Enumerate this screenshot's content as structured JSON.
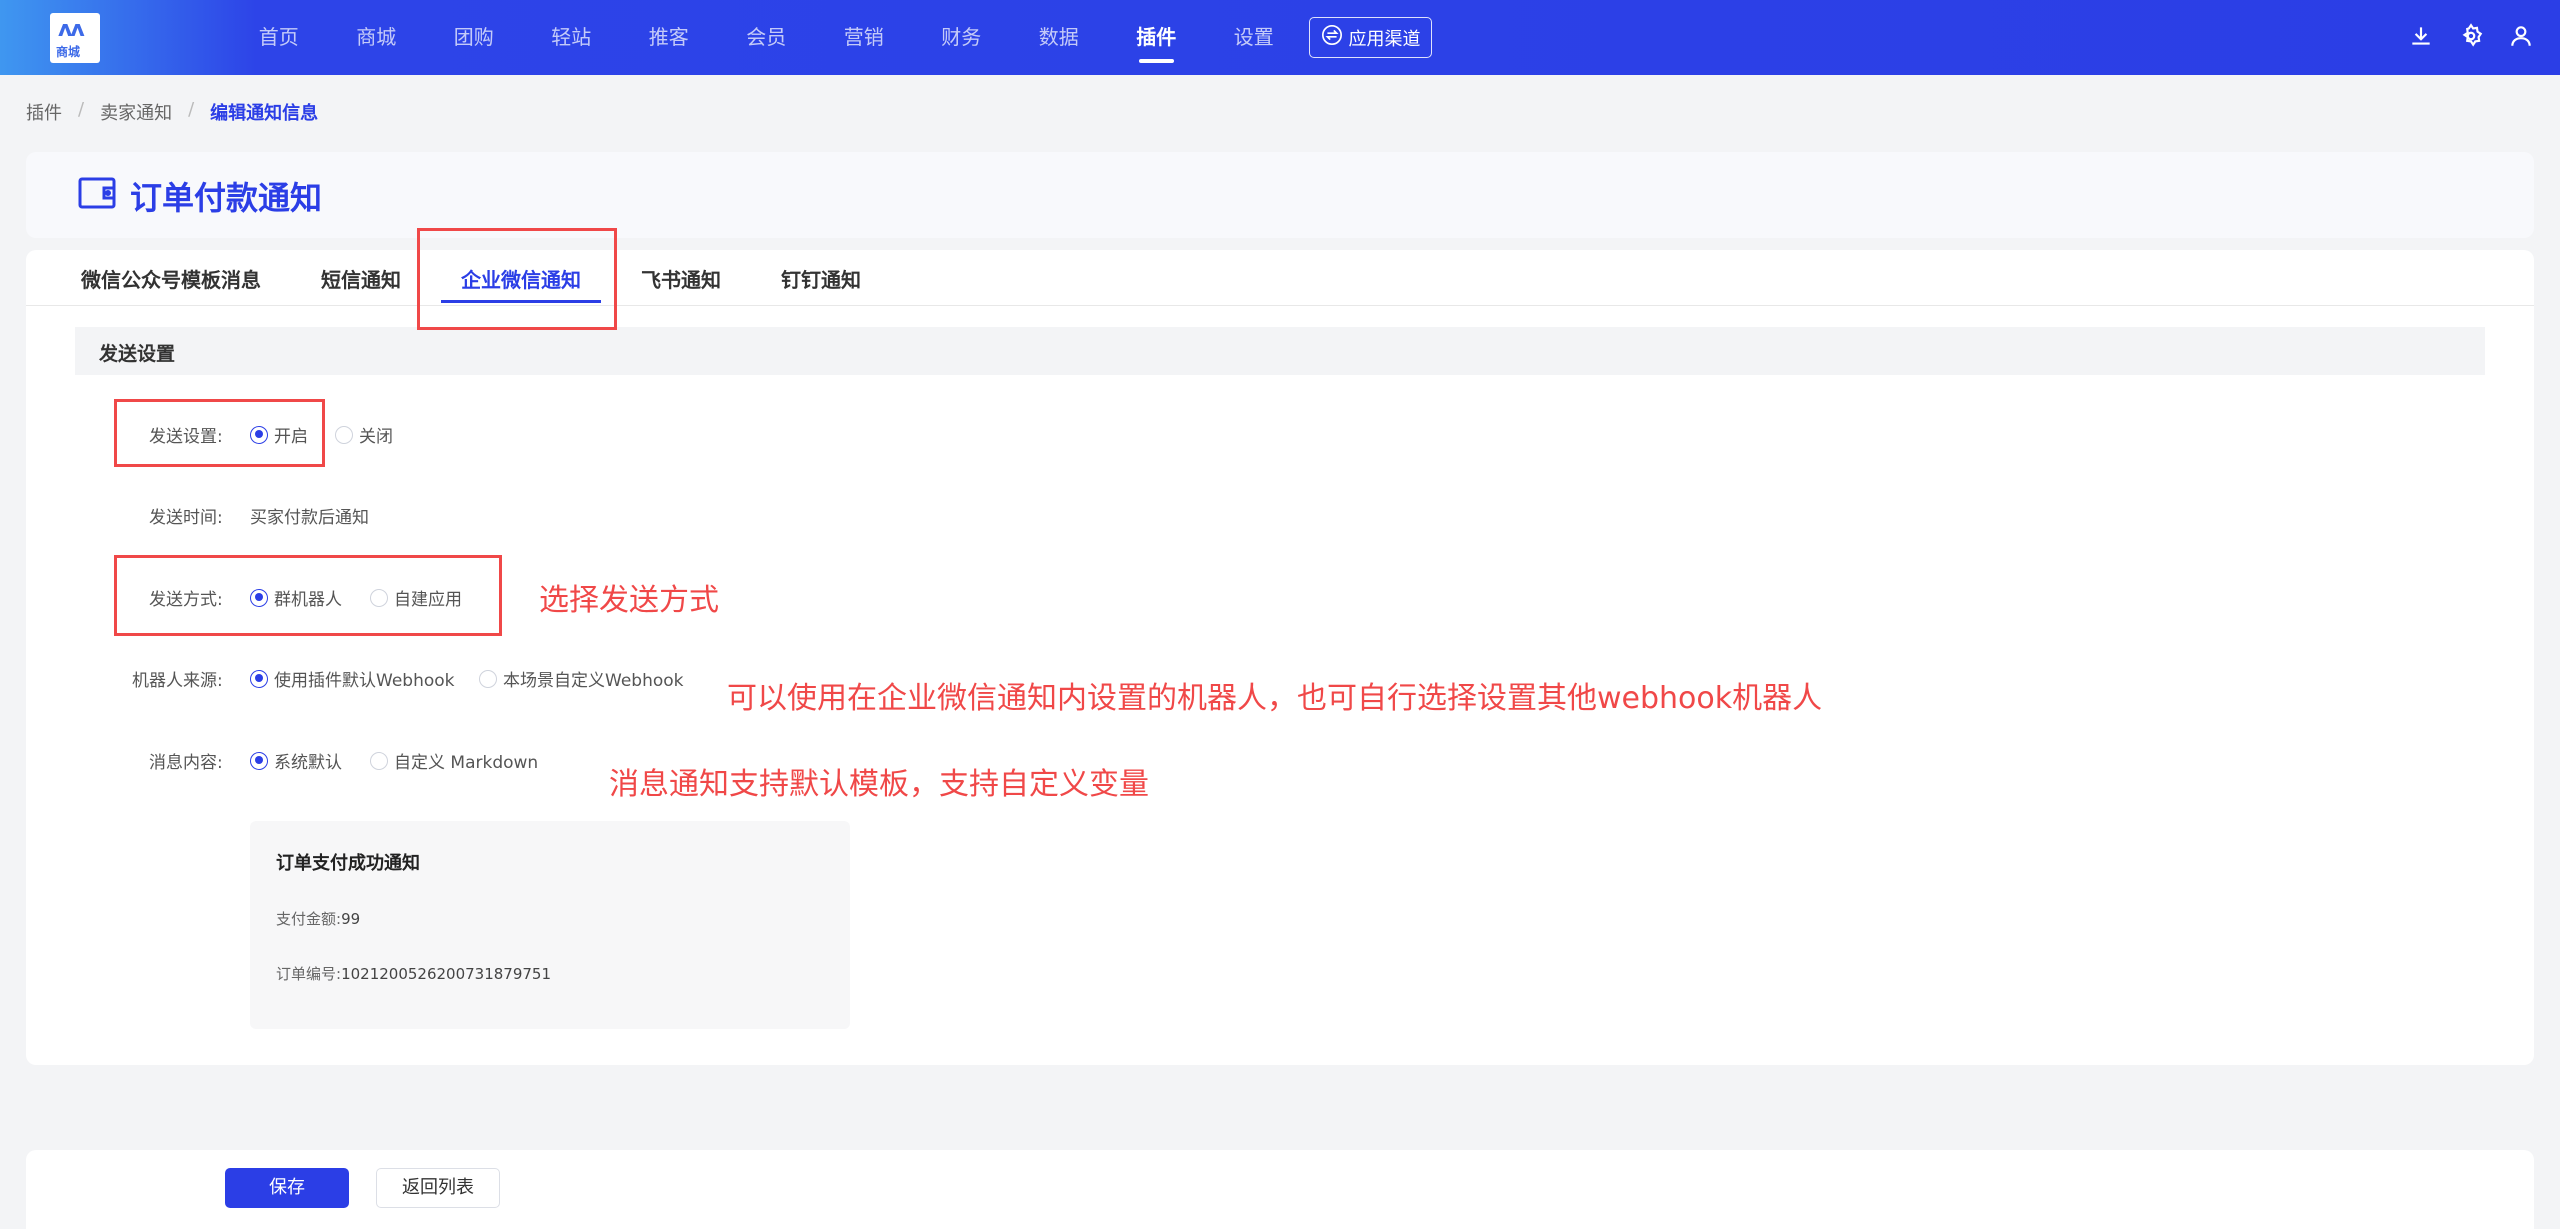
{
  "app": {
    "logo_mark": "ʌʌ",
    "logo_text": "商城"
  },
  "nav": {
    "items": [
      {
        "label": "首页"
      },
      {
        "label": "商城"
      },
      {
        "label": "团购"
      },
      {
        "label": "轻站"
      },
      {
        "label": "推客"
      },
      {
        "label": "会员"
      },
      {
        "label": "营销"
      },
      {
        "label": "财务"
      },
      {
        "label": "数据"
      },
      {
        "label": "插件",
        "active": true
      },
      {
        "label": "设置"
      }
    ],
    "channel_button": "应用渠道",
    "icons": [
      "download-icon",
      "settings-icon",
      "user-icon"
    ]
  },
  "breadcrumb": {
    "items": [
      "插件",
      "卖家通知",
      "编辑通知信息"
    ],
    "separator": "/"
  },
  "page": {
    "title": "订单付款通知",
    "title_icon": "wallet-icon"
  },
  "tabs": {
    "items": [
      "微信公众号模板消息",
      "短信通知",
      "企业微信通知",
      "飞书通知",
      "钉钉通知"
    ],
    "active_index": 2
  },
  "section": {
    "title": "发送设置"
  },
  "form": {
    "send_setting": {
      "label": "发送设置:",
      "options": [
        "开启",
        "关闭"
      ],
      "selected": "开启"
    },
    "send_time": {
      "label": "发送时间:",
      "value": "买家付款后通知"
    },
    "send_method": {
      "label": "发送方式:",
      "options": [
        "群机器人",
        "自建应用"
      ],
      "selected": "群机器人"
    },
    "robot_source": {
      "label": "机器人来源:",
      "options": [
        "使用插件默认Webhook",
        "本场景自定义Webhook"
      ],
      "selected": "使用插件默认Webhook"
    },
    "message_content": {
      "label": "消息内容:",
      "options": [
        "系统默认",
        "自定义 Markdown"
      ],
      "selected": "系统默认"
    }
  },
  "preview": {
    "title": "订单支付成功通知",
    "rows": [
      {
        "label": "支付金额:",
        "value": "99"
      },
      {
        "label": "订单编号:",
        "value": "1021200526200731879751"
      }
    ]
  },
  "annotations": {
    "send_method": "选择发送方式",
    "robot_source": "可以使用在企业微信通知内设置的机器人，也可自行选择设置其他webhook机器人",
    "message_content": "消息通知支持默认模板，支持自定义变量"
  },
  "footer": {
    "save_label": "保存",
    "back_label": "返回列表"
  },
  "colors": {
    "primary": "#2b3ee6",
    "annotation_red": "#f04848"
  }
}
